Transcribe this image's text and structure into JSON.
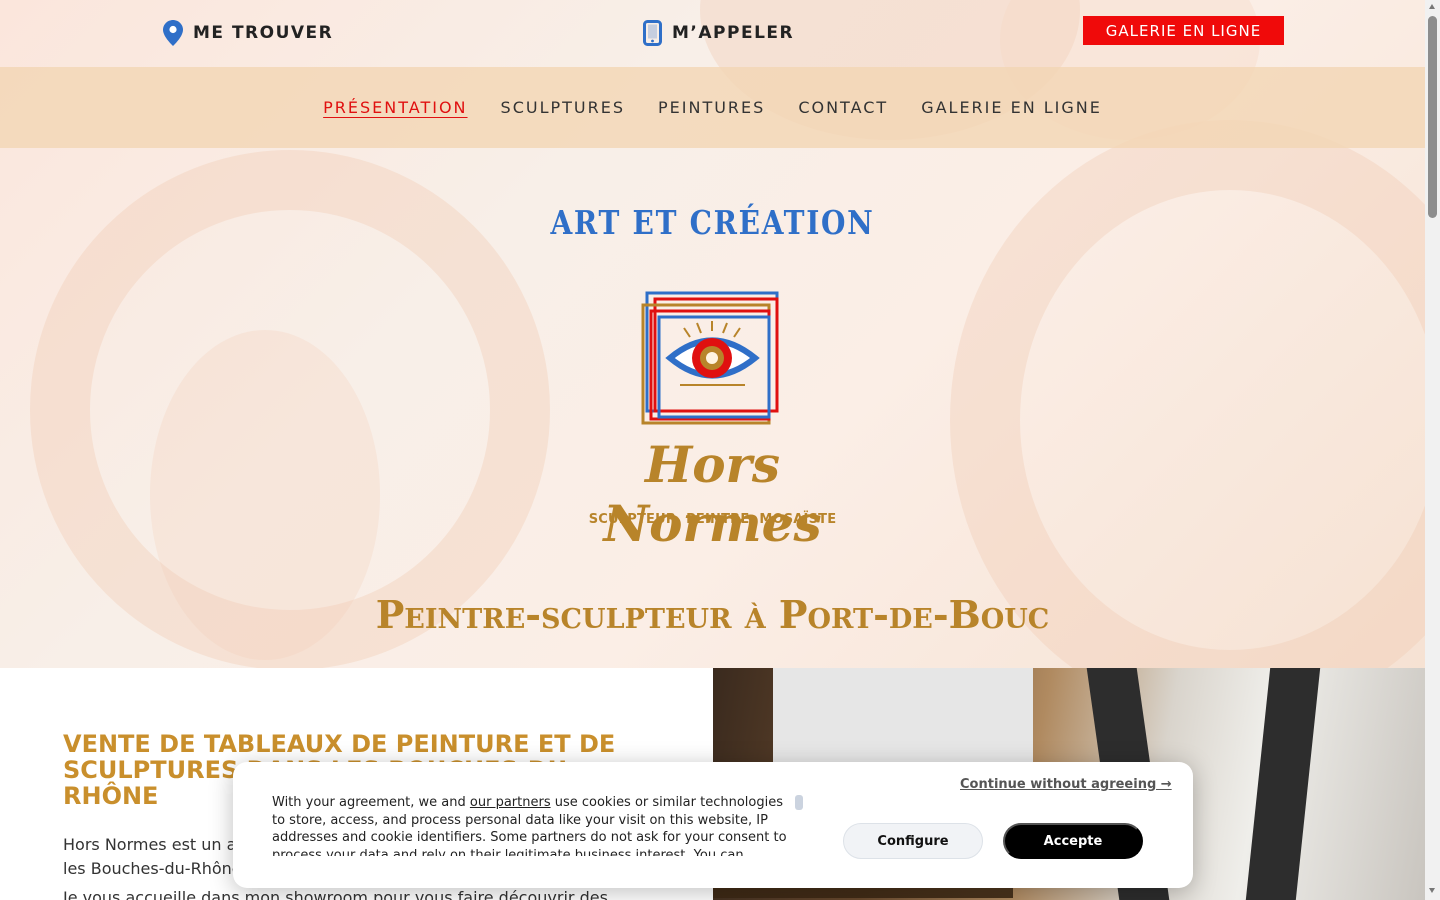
{
  "topbar": {
    "locate_label": "ME TROUVER",
    "call_label": "M’APPELER",
    "gallery_button": "GALERIE EN LIGNE"
  },
  "nav": {
    "items": [
      {
        "label": "PRÉSENTATION",
        "active": true
      },
      {
        "label": "SCULPTURES",
        "active": false
      },
      {
        "label": "PEINTURES",
        "active": false
      },
      {
        "label": "CONTACT",
        "active": false
      },
      {
        "label": "GALERIE EN LIGNE",
        "active": false
      }
    ]
  },
  "hero": {
    "tagline": "ART ET CRÉATION",
    "logo_name": "Hors Normes",
    "logo_subtitle": "SCULPTEUR, PEINTRE, MOSAÏSTE",
    "subtitle": "Peintre-sculpteur à Port-de-Bouc"
  },
  "section": {
    "title": "VENTE DE TABLEAUX DE PEINTURE ET DE SCULPTURES DANS LES BOUCHES-DU-RHÔNE",
    "paragraph1": "Hors Normes est un artiste peintre-sculpteur installé à Port-de-Bouc dans les Bouches-du-Rhône.",
    "paragraph2": "Je vous accueille dans mon showroom pour vous faire découvrir des"
  },
  "cookie": {
    "text_before_link": "With your agreement, we and ",
    "link_text": "our partners",
    "text_after_link": " use cookies or similar technologies to store, access, and process personal data like your visit on this website, IP addresses and cookie identifiers. Some partners do not ask for your consent to process your data and rely on their legitimate business interest. You can",
    "continue_label": "Continue without agreeing →",
    "configure_label": "Configure",
    "accept_label": "Accepte"
  },
  "colors": {
    "accent_red": "#f00a0a",
    "tagline_blue": "#2f6fc8",
    "gold": "#b8842a",
    "section_title": "#c98f2c",
    "nav_bg": "#f2d6b4"
  }
}
